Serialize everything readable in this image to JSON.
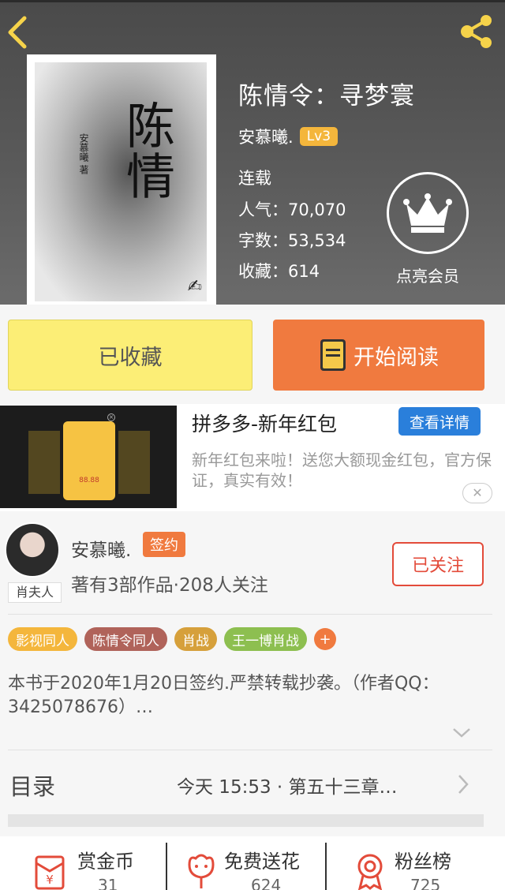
{
  "book": {
    "title": "陈情令：寻梦寰",
    "author": "安慕曦.",
    "level": "Lv3",
    "status": "连载",
    "popularity": "人气：70,070",
    "words": "字数：53,534",
    "favorites": "收藏：614",
    "vip_label": "点亮会员",
    "cover_title": "陈情",
    "cover_author": "安慕曦 著"
  },
  "actions": {
    "collected": "已收藏",
    "start_reading": "开始阅读"
  },
  "ad": {
    "title": "拼多多-新年红包",
    "detail_button": "查看详情",
    "description": "新年红包来啦！送您大额现金红包，官方保证，真实有效！",
    "card_amount": "88.88",
    "close": "✕"
  },
  "author": {
    "name": "安慕曦.",
    "badge": "签约",
    "stats": "著有3部作品·208人关注",
    "follow": "已关注",
    "avatar_tag": "肖夫人"
  },
  "tags": [
    {
      "label": "影视同人",
      "color": "#f4b63c"
    },
    {
      "label": "陈情令同人",
      "color": "#b0635a"
    },
    {
      "label": "肖战",
      "color": "#d6a03b"
    },
    {
      "label": "王一博肖战",
      "color": "#8dbf50"
    }
  ],
  "tag_add": "+",
  "intro": "本书于2020年1月20日签约.严禁转载抄袭。（作者QQ：3425078676）…",
  "toc": {
    "label": "目录",
    "latest": "今天 15:53 · 第五十三章…"
  },
  "bottom": [
    {
      "label": "赏金币",
      "value": "31",
      "icon": "reward-coin-icon"
    },
    {
      "label": "免费送花",
      "value": "624",
      "icon": "flower-icon"
    },
    {
      "label": "粉丝榜",
      "value": "725",
      "icon": "medal-icon"
    }
  ],
  "colors": {
    "accent_orange": "#f07a3f",
    "collected_yellow": "#fcee76",
    "follow_red": "#e34b3a",
    "ad_blue": "#2a7fdb",
    "level_gold": "#f4b63c"
  }
}
